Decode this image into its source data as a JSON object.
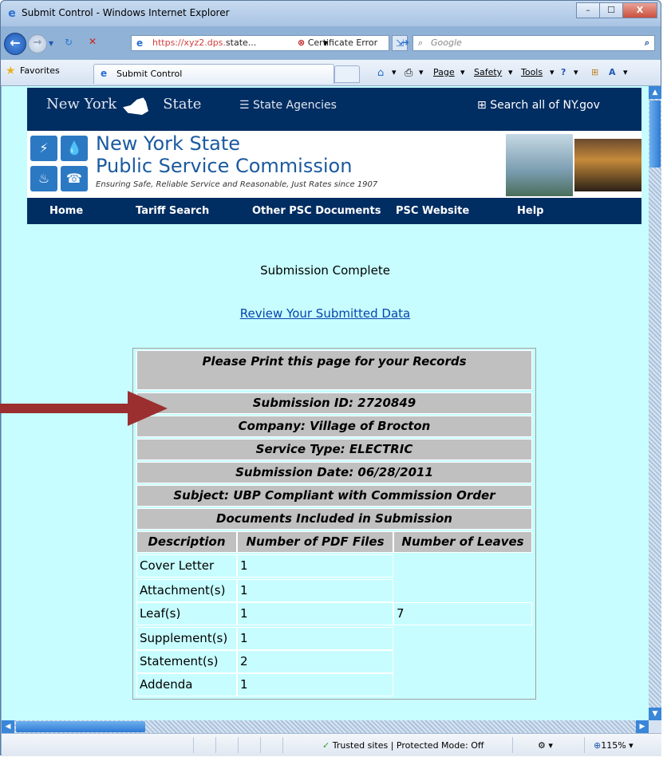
{
  "window": {
    "title": "Submit Control - Windows Internet Explorer",
    "min_glyph": "–",
    "max_glyph": "☐",
    "close_glyph": "X"
  },
  "address_bar": {
    "url_prefix": "https://xyz2.dps.",
    "url_domain": "state...",
    "dropdown_glyph": "▾",
    "cert_error": "Certificate Error",
    "search_placeholder": "Google"
  },
  "favorites_bar": {
    "favorites_label": "Favorites",
    "tab_label": "Submit Control",
    "page_menu": "Page",
    "safety_menu": "Safety",
    "tools_menu": "Tools"
  },
  "site_header": {
    "state_left": "New York",
    "state_right": "State",
    "agencies": "State Agencies",
    "search_all": "Search all of NY.gov"
  },
  "banner": {
    "title_line1": "New York State",
    "title_line2": "Public Service Commission",
    "tagline": "Ensuring Safe, Reliable Service and Reasonable, Just Rates since 1907"
  },
  "nav": {
    "items": [
      "Home",
      "Tariff Search",
      "Other PSC Documents",
      "PSC Website",
      "Help"
    ]
  },
  "content": {
    "status": "Submission Complete",
    "review_link": "Review Your Submitted Data",
    "print_notice": "Please Print this page for your Records",
    "submission_id": "Submission ID: 2720849",
    "company": "Company: Village of Brocton",
    "service_type": "Service Type: ELECTRIC",
    "submission_date": "Submission Date: 06/28/2011",
    "subject": "Subject: UBP Compliant with Commission Order",
    "documents_heading": "Documents Included in Submission",
    "columns": [
      "Description",
      "Number of PDF Files",
      "Number of Leaves"
    ],
    "rows": [
      {
        "description": "Cover Letter",
        "pdf_files": "1"
      },
      {
        "description": "Attachment(s)",
        "pdf_files": "1"
      },
      {
        "description": "Leaf(s)",
        "pdf_files": "1",
        "leaves": "7"
      },
      {
        "description": "Supplement(s)",
        "pdf_files": "1"
      },
      {
        "description": "Statement(s)",
        "pdf_files": "2"
      },
      {
        "description": "Addenda",
        "pdf_files": "1"
      }
    ]
  },
  "status_bar": {
    "zone": "Trusted sites | Protected Mode: Off",
    "zoom": "115%"
  },
  "annotation": {
    "arrow_color": "#9b2f2f"
  }
}
